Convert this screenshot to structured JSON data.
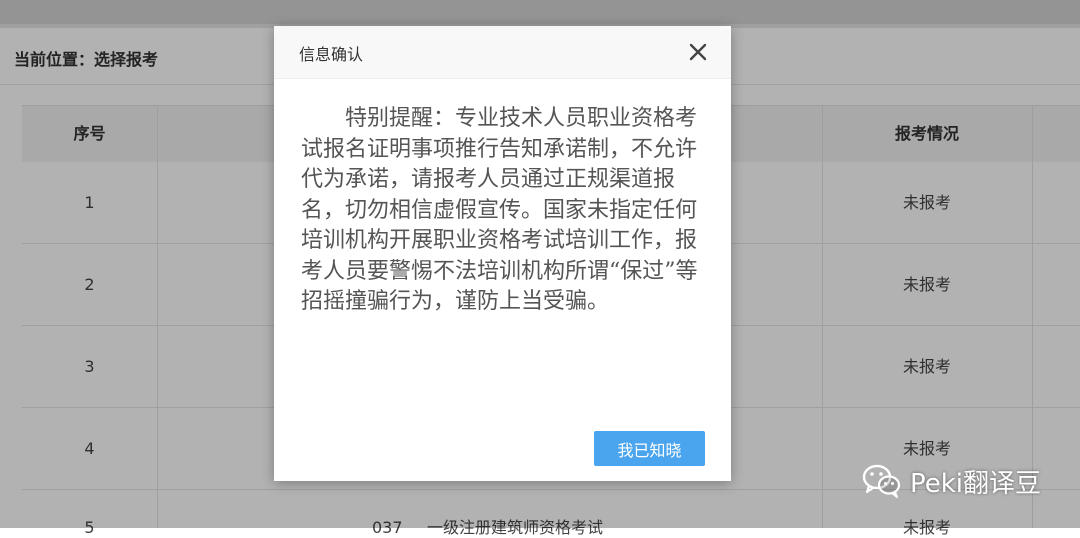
{
  "breadcrumb": {
    "label": "当前位置：",
    "current": "选择报考"
  },
  "table": {
    "headers": {
      "index": "序号",
      "status": "报考情况"
    },
    "rows": [
      {
        "index": "1",
        "status": "未报考"
      },
      {
        "index": "2",
        "status": "未报考"
      },
      {
        "index": "3",
        "status": "未报考"
      },
      {
        "index": "4",
        "status": "未报考"
      },
      {
        "index": "5",
        "code": "037",
        "name": "一级注册建筑师资格考试",
        "status": "未报考"
      }
    ]
  },
  "modal": {
    "title": "信息确认",
    "close_icon": "close-icon",
    "body": "特别提醒：专业技术人员职业资格考试报名证明事项推行告知承诺制，不允许代为承诺，请报考人员通过正规渠道报名，切勿相信虚假宣传。国家未指定任何培训机构开展职业资格考试培训工作，报考人员要警惕不法培训机构所谓“保过”等招摇撞骗行为，谨防上当受骗。",
    "ack_button": "我已知晓"
  },
  "watermark": {
    "text": "Peki翻译豆",
    "logo_icon": "wechat-icon"
  },
  "colors": {
    "primary_button": "#4aa4ee",
    "overlay": "rgba(0,0,0,0.3)"
  }
}
